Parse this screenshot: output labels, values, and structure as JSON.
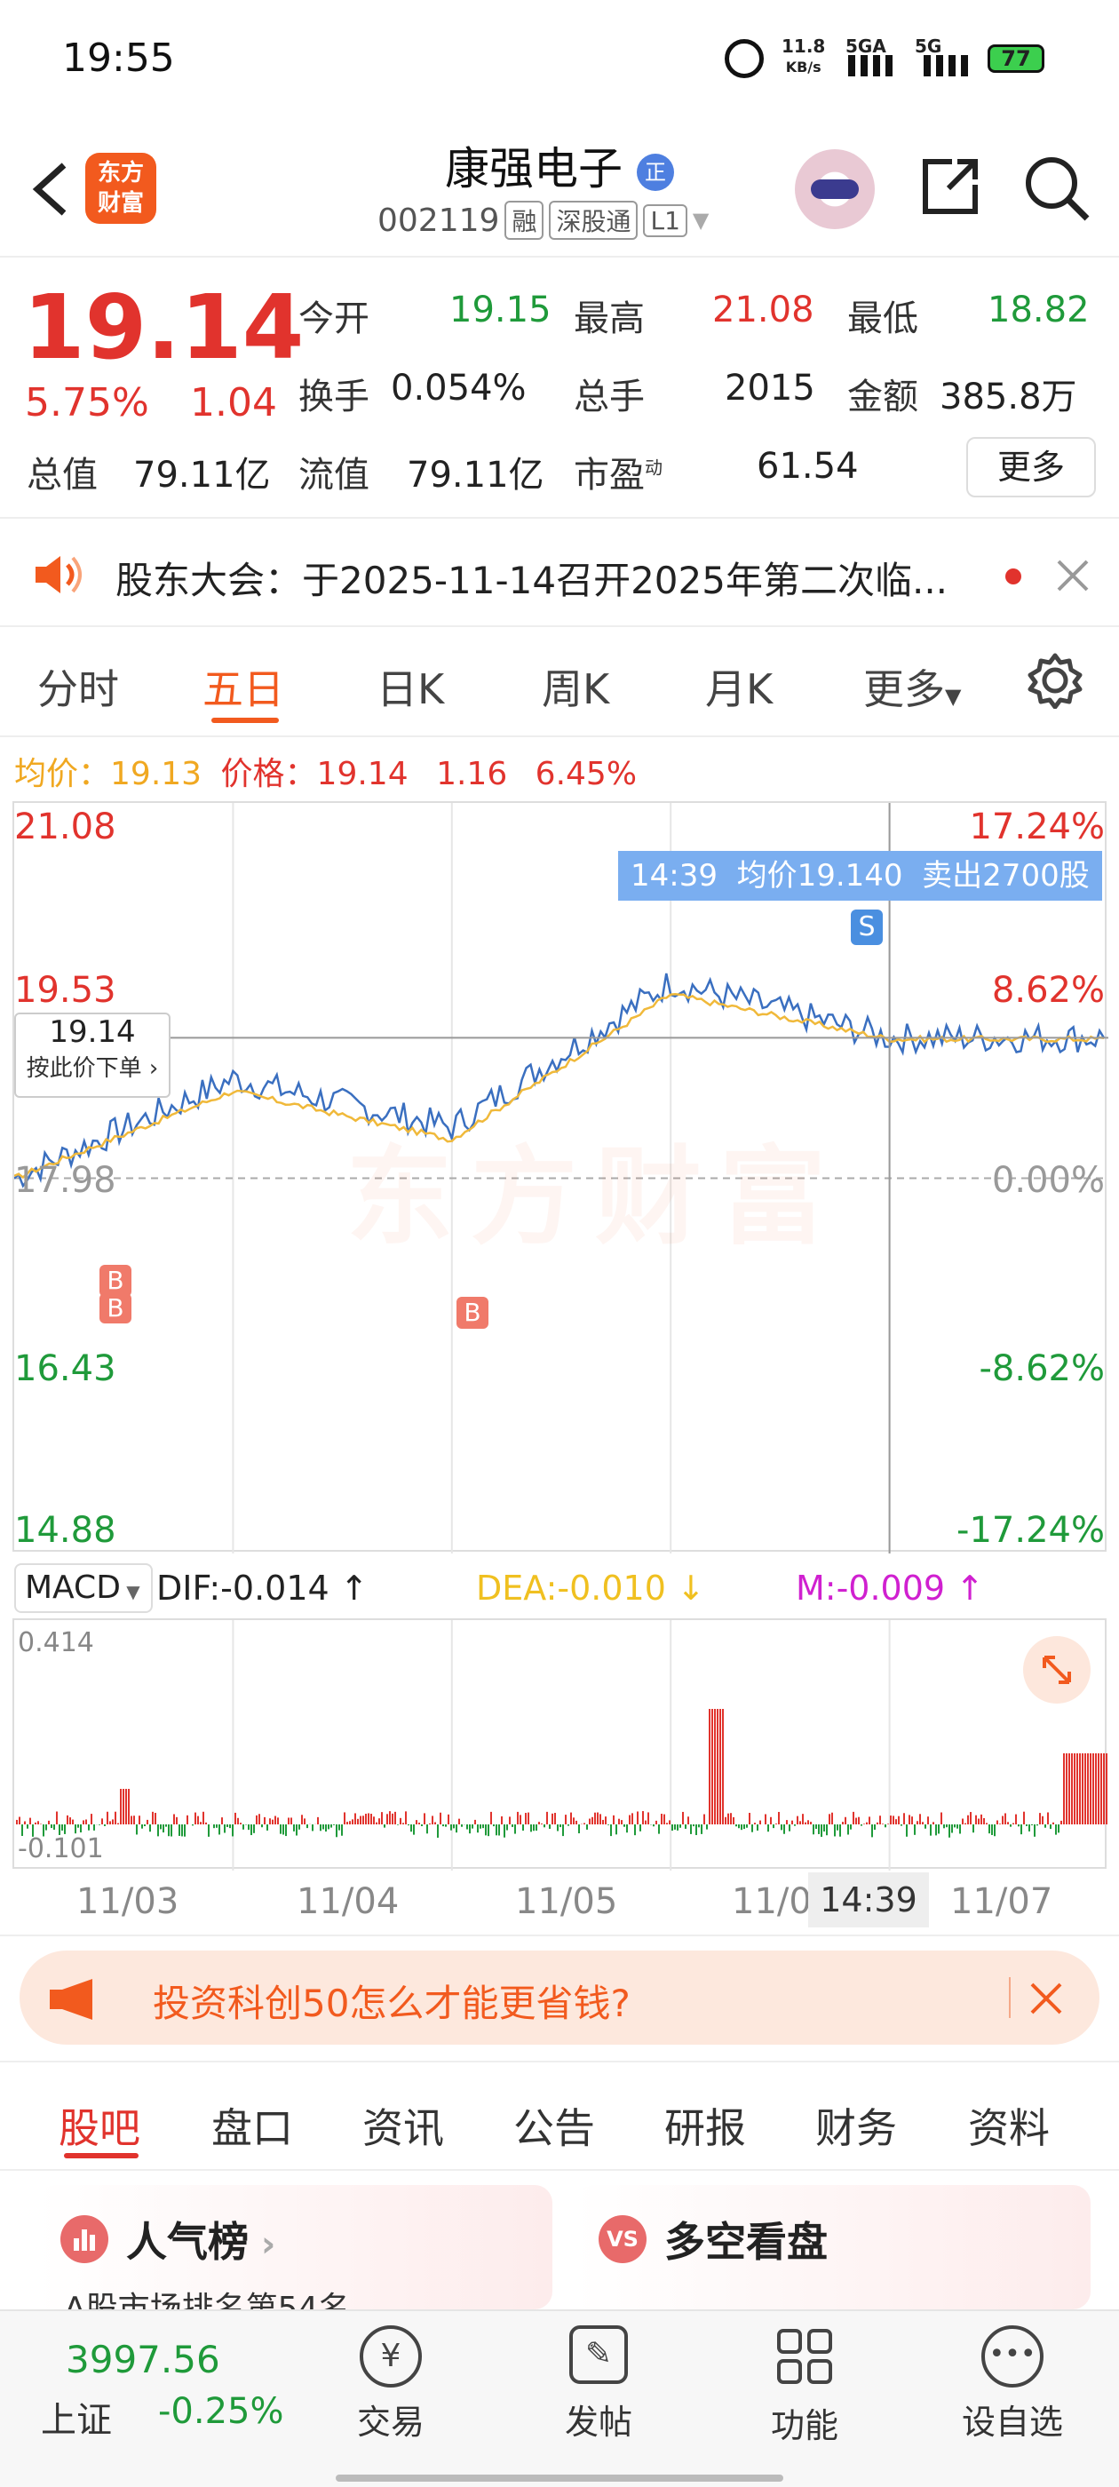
{
  "status_bar": {
    "time": "19:55",
    "speed_top": "11.8",
    "speed_unit": "KB/s",
    "sig1": "5GA",
    "sig2": "5G",
    "battery": "77"
  },
  "header": {
    "logo_line1": "东方",
    "logo_line2": "财富",
    "stock_name": "康强电子",
    "name_badge": "正",
    "stock_code": "002119",
    "tags": [
      "融",
      "深股通",
      "L1"
    ]
  },
  "quote": {
    "price": "19.14",
    "pct": "5.75%",
    "change": "1.04",
    "fields": [
      {
        "label": "今开",
        "value": "19.15",
        "color": "green"
      },
      {
        "label": "最高",
        "value": "21.08",
        "color": "red"
      },
      {
        "label": "最低",
        "value": "18.82",
        "color": "green"
      },
      {
        "label": "换手",
        "value": "0.054%",
        "color": "black"
      },
      {
        "label": "总手",
        "value": "2015",
        "color": "black"
      },
      {
        "label": "金额",
        "value": "385.8万",
        "color": "black"
      },
      {
        "label": "总值",
        "value": "79.11亿",
        "color": "black"
      },
      {
        "label": "流值",
        "value": "79.11亿",
        "color": "black"
      },
      {
        "label": "市盈",
        "value": "61.54",
        "color": "black"
      }
    ],
    "pe_sup": "动",
    "more_label": "更多"
  },
  "notice": {
    "text": "股东大会：于2025-11-14召开2025年第二次临..."
  },
  "chart_tabs": [
    "分时",
    "五日",
    "日K",
    "周K",
    "月K",
    "更多"
  ],
  "active_tab": "五日",
  "legend": {
    "avg_label": "均价：",
    "avg_value": "19.13",
    "price_label": "价格：",
    "price_value": "19.14",
    "chg": "1.16",
    "pct": "6.45%"
  },
  "chart": {
    "left_labels": [
      "21.08",
      "19.53",
      "17.98",
      "16.43",
      "14.88"
    ],
    "right_labels": [
      "17.24%",
      "8.62%",
      "0.00%",
      "-8.62%",
      "-17.24%"
    ],
    "crosshair_price": "19.14",
    "order_label": "按此价下单",
    "tooltip": "14:39  均价19.140  卖出2700股",
    "sell_marker": "S",
    "buy_marker": "B",
    "x_labels": [
      "11/03",
      "11/04",
      "11/05",
      "11/0",
      "11/07"
    ],
    "cross_time": "14:39",
    "watermark": "东方财富"
  },
  "macd": {
    "selector": "MACD",
    "dif": "DIF:-0.014 ↑",
    "dea": "DEA:-0.010 ↓",
    "m": "M:-0.009 ↑",
    "top": "0.414",
    "bottom": "-0.101"
  },
  "chart_data": {
    "type": "line",
    "title": "",
    "x": [
      "11/03",
      "11/04",
      "11/05",
      "11/06",
      "11/07"
    ],
    "series": [
      {
        "name": "价格",
        "values": [
          17.98,
          18.8,
          18.4,
          19.6,
          19.14
        ]
      },
      {
        "name": "均价",
        "values": [
          17.98,
          18.7,
          18.3,
          19.5,
          19.13
        ]
      }
    ],
    "ylim": [
      14.88,
      21.08
    ]
  },
  "ad_banner": {
    "text": "投资科创50怎么才能更省钱?"
  },
  "sub_tabs": [
    "股吧",
    "盘口",
    "资讯",
    "公告",
    "研报",
    "财务",
    "资料"
  ],
  "cards": [
    {
      "title": "人气榜",
      "sub": "A股市场排名第54名"
    },
    {
      "title": "多空看盘"
    }
  ],
  "bottom_nav": {
    "index_value": "3997.56",
    "index_name": "上证",
    "index_pct": "-0.25%",
    "items": [
      "交易",
      "发帖",
      "功能",
      "设自选"
    ]
  }
}
